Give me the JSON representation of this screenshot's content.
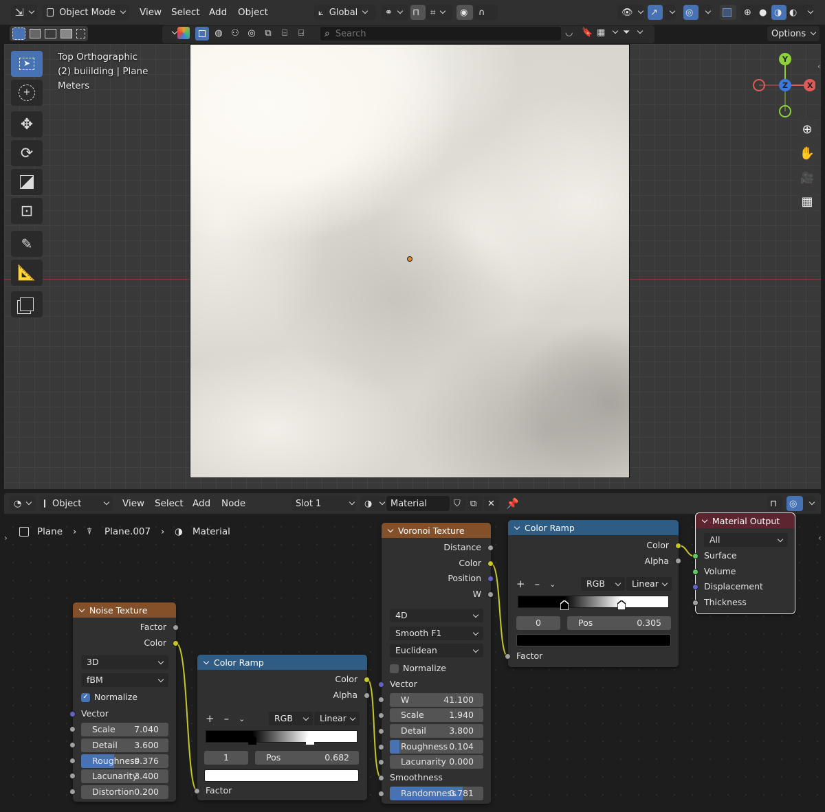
{
  "top_header": {
    "mode_label": "Object Mode",
    "menus": [
      "View",
      "Select",
      "Add",
      "Object"
    ],
    "orientation_label": "Global",
    "options_label": "Options",
    "search_placeholder": "Search"
  },
  "viewport": {
    "view_name": "Top Orthographic",
    "collection_line": "(2) buiilding | Plane",
    "units": "Meters",
    "gizmo": {
      "x": "X",
      "y": "Y",
      "z": "Z"
    }
  },
  "node_header": {
    "editor_type_label": "Object",
    "menus": [
      "View",
      "Select",
      "Add",
      "Node"
    ],
    "slot_label": "Slot 1",
    "material_name": "Material"
  },
  "breadcrumb": {
    "object": "Plane",
    "mesh": "Plane.007",
    "material": "Material"
  },
  "nodes": {
    "noise": {
      "title": "Noise Texture",
      "outputs": [
        "Factor",
        "Color"
      ],
      "dimensions": "3D",
      "type": "fBM",
      "normalize_label": "Normalize",
      "normalize_checked": true,
      "vector_label": "Vector",
      "fields": [
        {
          "label": "Scale",
          "value": "7.040",
          "fill": 0
        },
        {
          "label": "Detail",
          "value": "3.600",
          "fill": 0
        },
        {
          "label": "Roughness",
          "value": "0.376",
          "fill": 0.376
        },
        {
          "label": "Lacunarity",
          "value": "3.400",
          "fill": 0
        },
        {
          "label": "Distortion",
          "value": "0.200",
          "fill": 0
        }
      ]
    },
    "ramp1": {
      "title": "Color Ramp",
      "outputs": [
        "Color",
        "Alpha"
      ],
      "color_mode": "RGB",
      "interpolation": "Linear",
      "active_stop": "1",
      "pos_label": "Pos",
      "pos_value": "0.682",
      "input_label": "Factor",
      "stops": [
        0.305,
        0.682
      ],
      "active_color": "#ffffff"
    },
    "voronoi": {
      "title": "Voronoi Texture",
      "outputs": [
        "Distance",
        "Color",
        "Position",
        "W"
      ],
      "dimensions": "4D",
      "feature": "Smooth F1",
      "metric": "Euclidean",
      "normalize_label": "Normalize",
      "normalize_checked": false,
      "vector_label": "Vector",
      "smoothness_label": "Smoothness",
      "fields": [
        {
          "label": "W",
          "value": "41.100",
          "fill": 0
        },
        {
          "label": "Scale",
          "value": "1.940",
          "fill": 0
        },
        {
          "label": "Detail",
          "value": "3.800",
          "fill": 0
        },
        {
          "label": "Roughness",
          "value": "0.104",
          "fill": 0.104
        },
        {
          "label": "Lacunarity",
          "value": "0.000",
          "fill": 0
        }
      ],
      "randomness": {
        "label": "Randomness",
        "value": "0.781",
        "fill": 0.781
      }
    },
    "ramp2": {
      "title": "Color Ramp",
      "outputs": [
        "Color",
        "Alpha"
      ],
      "color_mode": "RGB",
      "interpolation": "Linear",
      "active_stop": "0",
      "pos_label": "Pos",
      "pos_value": "0.305",
      "input_label": "Factor",
      "stops": [
        0.305,
        0.682
      ],
      "active_color": "#000000"
    },
    "output": {
      "title": "Material Output",
      "target": "All",
      "inputs": [
        "Surface",
        "Volume",
        "Displacement",
        "Thickness"
      ]
    }
  },
  "colors": {
    "accent": "#4772b3",
    "texture_header": "#84502a",
    "converter_header": "#2e5c84",
    "output_header": "#5c2530",
    "socket_color": "#c7c729",
    "socket_float": "#a1a1a1",
    "socket_vector": "#6363c7",
    "socket_shader": "#63c763"
  }
}
